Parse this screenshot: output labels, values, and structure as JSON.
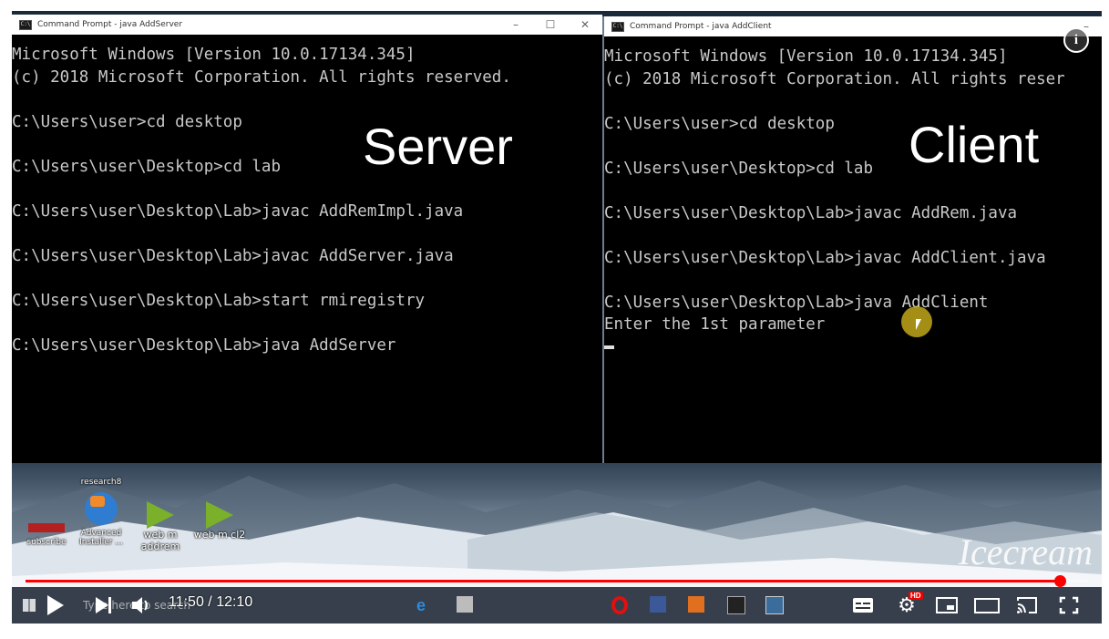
{
  "server_window": {
    "title": "Command Prompt - java  AddServer",
    "overlay_label": "Server",
    "lines": [
      "Microsoft Windows [Version 10.0.17134.345]",
      "(c) 2018 Microsoft Corporation. All rights reserved.",
      "",
      "C:\\Users\\user>cd desktop",
      "",
      "C:\\Users\\user\\Desktop>cd lab",
      "",
      "C:\\Users\\user\\Desktop\\Lab>javac AddRemImpl.java",
      "",
      "C:\\Users\\user\\Desktop\\Lab>javac AddServer.java",
      "",
      "C:\\Users\\user\\Desktop\\Lab>start rmiregistry",
      "",
      "C:\\Users\\user\\Desktop\\Lab>java AddServer"
    ]
  },
  "client_window": {
    "title": "Command Prompt - java  AddClient",
    "overlay_label": "Client",
    "lines": [
      "Microsoft Windows [Version 10.0.17134.345]",
      "(c) 2018 Microsoft Corporation. All rights reser",
      "",
      "C:\\Users\\user>cd desktop",
      "",
      "C:\\Users\\user\\Desktop>cd lab",
      "",
      "C:\\Users\\user\\Desktop\\Lab>javac AddRem.java",
      "",
      "C:\\Users\\user\\Desktop\\Lab>javac AddClient.java",
      "",
      "C:\\Users\\user\\Desktop\\Lab>java AddClient",
      "Enter the 1st parameter"
    ]
  },
  "desktop": {
    "icons": [
      {
        "label": "subscribe"
      },
      {
        "label": "Advanced Installer ...",
        "top_label": "research8"
      },
      {
        "label": "web m addrem"
      },
      {
        "label": "web m cl2"
      }
    ],
    "watermark": "Icecream",
    "search_placeholder": "Type here to search"
  },
  "player": {
    "time": "11:50 / 12:10",
    "progress": 0.973,
    "hd_badge": "HD",
    "info_icon": "i",
    "accent": "#ff0000"
  }
}
